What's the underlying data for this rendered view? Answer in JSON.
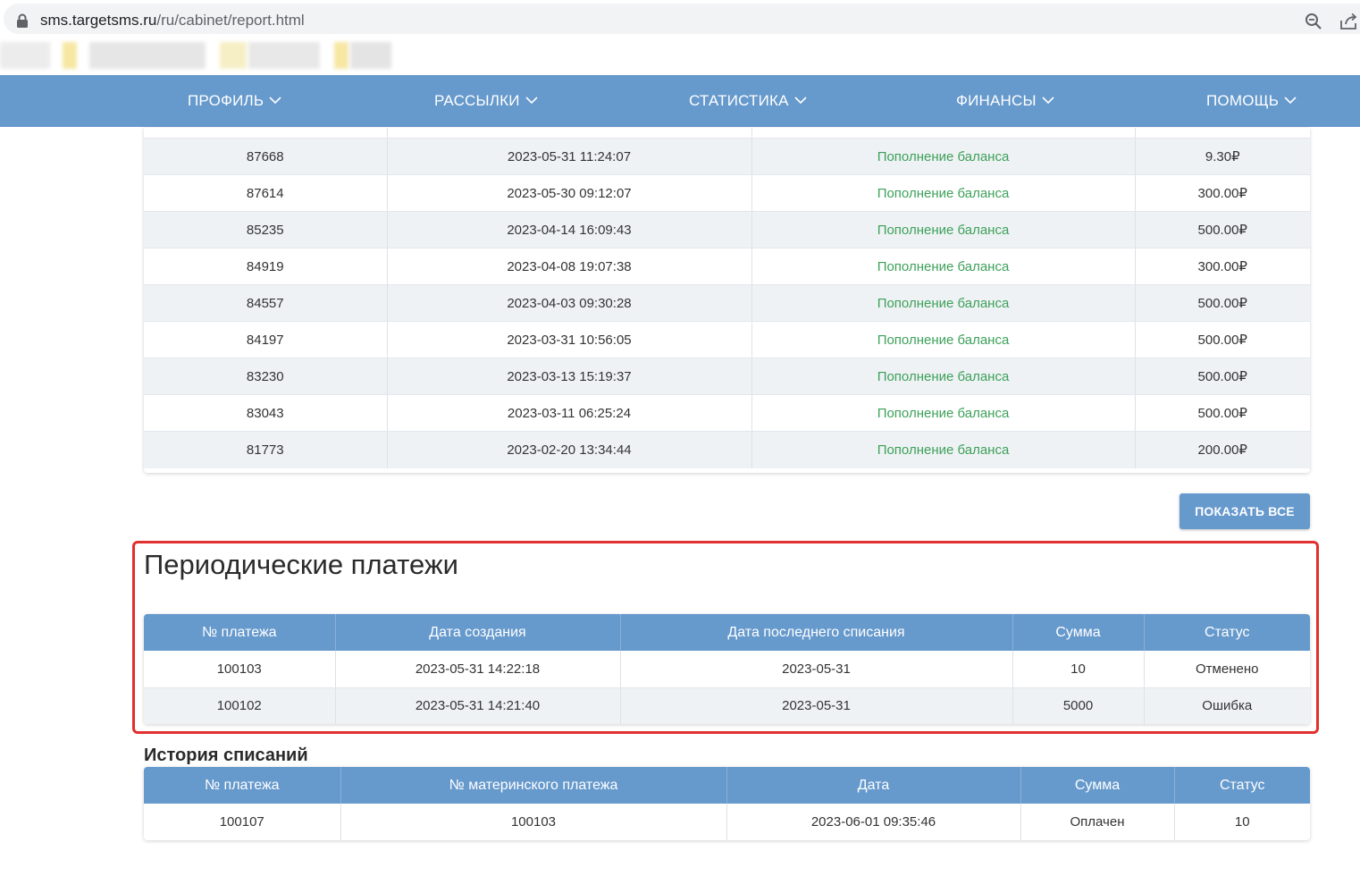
{
  "browser": {
    "url_domain": "sms.targetsms.ru",
    "url_path": "/ru/cabinet/report.html"
  },
  "nav": {
    "items": [
      {
        "label": "ПРОФИЛЬ"
      },
      {
        "label": "РАССЫЛКИ"
      },
      {
        "label": "СТАТИСТИКА"
      },
      {
        "label": "ФИНАНСЫ"
      },
      {
        "label": "ПОМОЩЬ"
      }
    ]
  },
  "payments": {
    "rows": [
      {
        "id": "87668",
        "date": "2023-05-31 11:24:07",
        "type": "Пополнение баланса",
        "amount": "9.30₽"
      },
      {
        "id": "87614",
        "date": "2023-05-30 09:12:07",
        "type": "Пополнение баланса",
        "amount": "300.00₽"
      },
      {
        "id": "85235",
        "date": "2023-04-14 16:09:43",
        "type": "Пополнение баланса",
        "amount": "500.00₽"
      },
      {
        "id": "84919",
        "date": "2023-04-08 19:07:38",
        "type": "Пополнение баланса",
        "amount": "300.00₽"
      },
      {
        "id": "84557",
        "date": "2023-04-03 09:30:28",
        "type": "Пополнение баланса",
        "amount": "500.00₽"
      },
      {
        "id": "84197",
        "date": "2023-03-31 10:56:05",
        "type": "Пополнение баланса",
        "amount": "500.00₽"
      },
      {
        "id": "83230",
        "date": "2023-03-13 15:19:37",
        "type": "Пополнение баланса",
        "amount": "500.00₽"
      },
      {
        "id": "83043",
        "date": "2023-03-11 06:25:24",
        "type": "Пополнение баланса",
        "amount": "500.00₽"
      },
      {
        "id": "81773",
        "date": "2023-02-20 13:34:44",
        "type": "Пополнение баланса",
        "amount": "200.00₽"
      }
    ],
    "show_all_label": "ПОКАЗАТЬ ВСЕ"
  },
  "periodic": {
    "title": "Периодические платежи",
    "headers": [
      "№ платежа",
      "Дата создания",
      "Дата последнего списания",
      "Сумма",
      "Статус"
    ],
    "rows": [
      {
        "id": "100103",
        "created": "2023-05-31 14:22:18",
        "last": "2023-05-31",
        "sum": "10",
        "status": "Отменено"
      },
      {
        "id": "100102",
        "created": "2023-05-31 14:21:40",
        "last": "2023-05-31",
        "sum": "5000",
        "status": "Ошибка"
      }
    ]
  },
  "history": {
    "title": "История списаний",
    "headers": [
      "№ платежа",
      "№ материнского платежа",
      "Дата",
      "Сумма",
      "Статус"
    ],
    "rows": [
      {
        "id": "100107",
        "parent": "100103",
        "date": "2023-06-01 09:35:46",
        "sum": "Оплачен",
        "status": "10"
      }
    ]
  },
  "colors": {
    "accent": "#6699cc",
    "success_text": "#3da15a",
    "highlight": "#e03030"
  }
}
